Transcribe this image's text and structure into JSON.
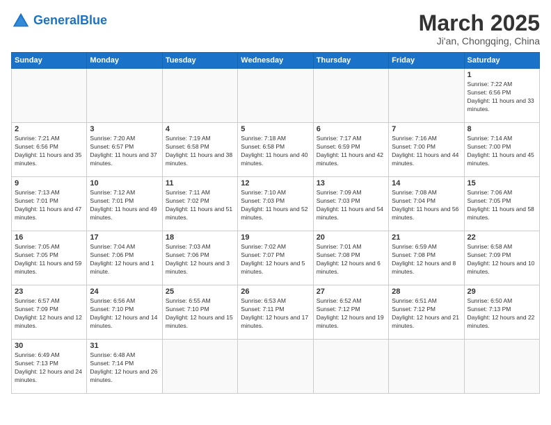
{
  "header": {
    "logo_general": "General",
    "logo_blue": "Blue",
    "month_title": "March 2025",
    "location": "Ji'an, Chongqing, China"
  },
  "weekdays": [
    "Sunday",
    "Monday",
    "Tuesday",
    "Wednesday",
    "Thursday",
    "Friday",
    "Saturday"
  ],
  "days": {
    "d1": {
      "num": "1",
      "sunrise": "Sunrise: 7:22 AM",
      "sunset": "Sunset: 6:56 PM",
      "daylight": "Daylight: 11 hours and 33 minutes."
    },
    "d2": {
      "num": "2",
      "sunrise": "Sunrise: 7:21 AM",
      "sunset": "Sunset: 6:56 PM",
      "daylight": "Daylight: 11 hours and 35 minutes."
    },
    "d3": {
      "num": "3",
      "sunrise": "Sunrise: 7:20 AM",
      "sunset": "Sunset: 6:57 PM",
      "daylight": "Daylight: 11 hours and 37 minutes."
    },
    "d4": {
      "num": "4",
      "sunrise": "Sunrise: 7:19 AM",
      "sunset": "Sunset: 6:58 PM",
      "daylight": "Daylight: 11 hours and 38 minutes."
    },
    "d5": {
      "num": "5",
      "sunrise": "Sunrise: 7:18 AM",
      "sunset": "Sunset: 6:58 PM",
      "daylight": "Daylight: 11 hours and 40 minutes."
    },
    "d6": {
      "num": "6",
      "sunrise": "Sunrise: 7:17 AM",
      "sunset": "Sunset: 6:59 PM",
      "daylight": "Daylight: 11 hours and 42 minutes."
    },
    "d7": {
      "num": "7",
      "sunrise": "Sunrise: 7:16 AM",
      "sunset": "Sunset: 7:00 PM",
      "daylight": "Daylight: 11 hours and 44 minutes."
    },
    "d8": {
      "num": "8",
      "sunrise": "Sunrise: 7:14 AM",
      "sunset": "Sunset: 7:00 PM",
      "daylight": "Daylight: 11 hours and 45 minutes."
    },
    "d9": {
      "num": "9",
      "sunrise": "Sunrise: 7:13 AM",
      "sunset": "Sunset: 7:01 PM",
      "daylight": "Daylight: 11 hours and 47 minutes."
    },
    "d10": {
      "num": "10",
      "sunrise": "Sunrise: 7:12 AM",
      "sunset": "Sunset: 7:01 PM",
      "daylight": "Daylight: 11 hours and 49 minutes."
    },
    "d11": {
      "num": "11",
      "sunrise": "Sunrise: 7:11 AM",
      "sunset": "Sunset: 7:02 PM",
      "daylight": "Daylight: 11 hours and 51 minutes."
    },
    "d12": {
      "num": "12",
      "sunrise": "Sunrise: 7:10 AM",
      "sunset": "Sunset: 7:03 PM",
      "daylight": "Daylight: 11 hours and 52 minutes."
    },
    "d13": {
      "num": "13",
      "sunrise": "Sunrise: 7:09 AM",
      "sunset": "Sunset: 7:03 PM",
      "daylight": "Daylight: 11 hours and 54 minutes."
    },
    "d14": {
      "num": "14",
      "sunrise": "Sunrise: 7:08 AM",
      "sunset": "Sunset: 7:04 PM",
      "daylight": "Daylight: 11 hours and 56 minutes."
    },
    "d15": {
      "num": "15",
      "sunrise": "Sunrise: 7:06 AM",
      "sunset": "Sunset: 7:05 PM",
      "daylight": "Daylight: 11 hours and 58 minutes."
    },
    "d16": {
      "num": "16",
      "sunrise": "Sunrise: 7:05 AM",
      "sunset": "Sunset: 7:05 PM",
      "daylight": "Daylight: 11 hours and 59 minutes."
    },
    "d17": {
      "num": "17",
      "sunrise": "Sunrise: 7:04 AM",
      "sunset": "Sunset: 7:06 PM",
      "daylight": "Daylight: 12 hours and 1 minute."
    },
    "d18": {
      "num": "18",
      "sunrise": "Sunrise: 7:03 AM",
      "sunset": "Sunset: 7:06 PM",
      "daylight": "Daylight: 12 hours and 3 minutes."
    },
    "d19": {
      "num": "19",
      "sunrise": "Sunrise: 7:02 AM",
      "sunset": "Sunset: 7:07 PM",
      "daylight": "Daylight: 12 hours and 5 minutes."
    },
    "d20": {
      "num": "20",
      "sunrise": "Sunrise: 7:01 AM",
      "sunset": "Sunset: 7:08 PM",
      "daylight": "Daylight: 12 hours and 6 minutes."
    },
    "d21": {
      "num": "21",
      "sunrise": "Sunrise: 6:59 AM",
      "sunset": "Sunset: 7:08 PM",
      "daylight": "Daylight: 12 hours and 8 minutes."
    },
    "d22": {
      "num": "22",
      "sunrise": "Sunrise: 6:58 AM",
      "sunset": "Sunset: 7:09 PM",
      "daylight": "Daylight: 12 hours and 10 minutes."
    },
    "d23": {
      "num": "23",
      "sunrise": "Sunrise: 6:57 AM",
      "sunset": "Sunset: 7:09 PM",
      "daylight": "Daylight: 12 hours and 12 minutes."
    },
    "d24": {
      "num": "24",
      "sunrise": "Sunrise: 6:56 AM",
      "sunset": "Sunset: 7:10 PM",
      "daylight": "Daylight: 12 hours and 14 minutes."
    },
    "d25": {
      "num": "25",
      "sunrise": "Sunrise: 6:55 AM",
      "sunset": "Sunset: 7:10 PM",
      "daylight": "Daylight: 12 hours and 15 minutes."
    },
    "d26": {
      "num": "26",
      "sunrise": "Sunrise: 6:53 AM",
      "sunset": "Sunset: 7:11 PM",
      "daylight": "Daylight: 12 hours and 17 minutes."
    },
    "d27": {
      "num": "27",
      "sunrise": "Sunrise: 6:52 AM",
      "sunset": "Sunset: 7:12 PM",
      "daylight": "Daylight: 12 hours and 19 minutes."
    },
    "d28": {
      "num": "28",
      "sunrise": "Sunrise: 6:51 AM",
      "sunset": "Sunset: 7:12 PM",
      "daylight": "Daylight: 12 hours and 21 minutes."
    },
    "d29": {
      "num": "29",
      "sunrise": "Sunrise: 6:50 AM",
      "sunset": "Sunset: 7:13 PM",
      "daylight": "Daylight: 12 hours and 22 minutes."
    },
    "d30": {
      "num": "30",
      "sunrise": "Sunrise: 6:49 AM",
      "sunset": "Sunset: 7:13 PM",
      "daylight": "Daylight: 12 hours and 24 minutes."
    },
    "d31": {
      "num": "31",
      "sunrise": "Sunrise: 6:48 AM",
      "sunset": "Sunset: 7:14 PM",
      "daylight": "Daylight: 12 hours and 26 minutes."
    }
  }
}
